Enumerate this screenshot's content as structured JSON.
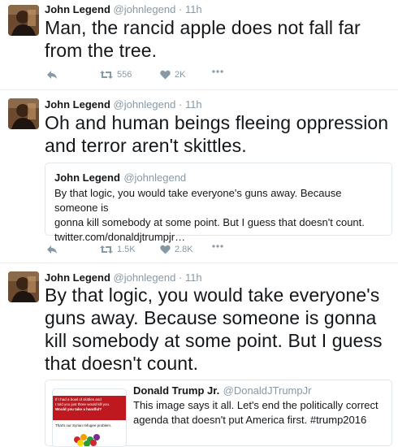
{
  "colors": {
    "name": "#14171a",
    "muted": "#8899a6",
    "border": "#e1e8ed",
    "accent": "#1da1f2",
    "thumb_red": "#c0181f"
  },
  "tweets": [
    {
      "name": "John Legend",
      "handle": "@johnlegend",
      "sep": "·",
      "time": "11h",
      "text_lines": [
        "Man, the rancid apple does not fall far",
        "from the tree."
      ],
      "retweets": "556",
      "likes": "2K",
      "icons": [
        "reply-icon",
        "retweet-icon",
        "heart-icon",
        "more-icon"
      ]
    },
    {
      "name": "John Legend",
      "handle": "@johnlegend",
      "sep": "·",
      "time": "11h",
      "text_lines": [
        "Oh and human beings fleeing oppression",
        "and terror aren't skittles."
      ],
      "quote": {
        "name": "John Legend",
        "handle": "@johnlegend",
        "text_lines": [
          "By that logic, you would take everyone's guns away. Because someone is",
          "gonna kill somebody at some point. But I guess that doesn't count.",
          "twitter.com/donaldjtrumpjr…"
        ]
      },
      "retweets": "1.5K",
      "likes": "2.8K"
    },
    {
      "name": "John Legend",
      "handle": "@johnlegend",
      "sep": "·",
      "time": "11h",
      "text_lines": [
        "By that logic, you would take everyone's",
        "guns away. Because someone is gonna",
        "kill somebody at some point. But I guess",
        "that doesn't count."
      ],
      "quote": {
        "name": "Donald Trump Jr.",
        "handle": "@DonaldJTrumpJr",
        "text_lines": [
          "This image says it all. Let's end the politically correct",
          "agenda that doesn't put America first. #trump2016"
        ],
        "thumbnail_lines": [
          "If I had a bowl of skittles and",
          "I told you just three would kill you.",
          "Would you take a handful?",
          "That's our Syrian refugee problem."
        ]
      }
    }
  ]
}
